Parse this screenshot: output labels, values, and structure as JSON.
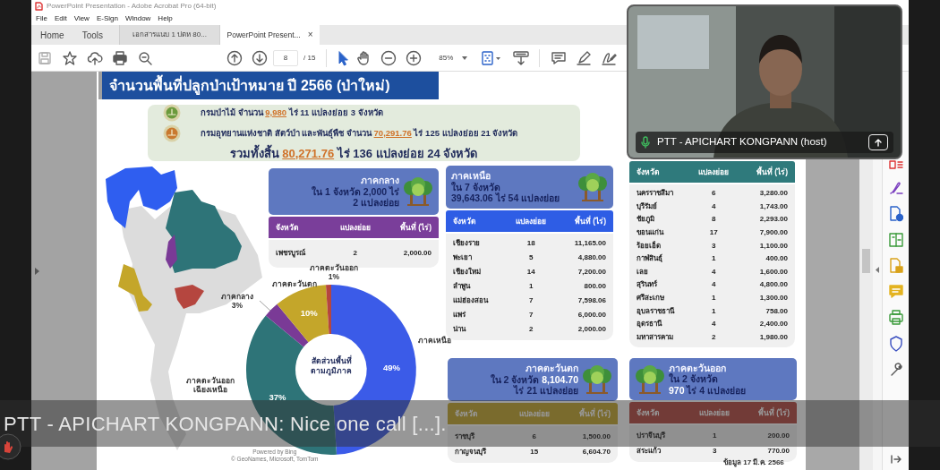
{
  "window": {
    "title": "PowerPoint Presentation - Adobe Acrobat Pro (64-bit)"
  },
  "menu": [
    "File",
    "Edit",
    "View",
    "E-Sign",
    "Window",
    "Help"
  ],
  "nav": [
    "Home",
    "Tools"
  ],
  "tabs": [
    {
      "label": "เอกสารแนบ 1 ปตห 80...",
      "selected": false
    },
    {
      "label": "PowerPoint Present...",
      "selected": true,
      "close": "×"
    }
  ],
  "toolbar": {
    "page": "8",
    "pages": "/ 15",
    "zoom": "85%"
  },
  "slide": {
    "title": "จำนวนพื้นที่ปลูกป่าเป้าหมาย ปี 2566 (ป่าใหม่)",
    "summary": [
      {
        "kind": "agency",
        "before": "กรมป่าไม้ จำนวน ",
        "amount": "9,980",
        "after": " ไร่ 11 แปลงย่อย 3 จังหวัด"
      },
      {
        "kind": "agency",
        "before": "กรมอุทยานแห่งชาติ สัตว์ป่า และพันธุ์พืช จำนวน ",
        "amount": "70,291.76",
        "after": " ไร่ 125 แปลงย่อย 21 จังหวัด"
      },
      {
        "kind": "total",
        "before": "รวมทั้งสิ้น ",
        "amount": "80,271.76",
        "after": " ไร่ 136 แปลงย่อย 24 จังหวัด"
      }
    ],
    "regions": [
      {
        "title": "ภาคกลาง",
        "lines": [
          [
            {
              "text": "ใน 1 จังหวัด 2,000 ไร่",
              "light": false
            }
          ],
          [
            {
              "text": "2 แปลงย่อย",
              "light": false
            }
          ]
        ],
        "color": "#7a3e9a",
        "columns": [
          "จังหวัด",
          "แปลงย่อย",
          "พื้นที่ (ไร่)"
        ],
        "rows": [
          [
            "เพชรบูรณ์",
            "2",
            "2,000.00"
          ]
        ]
      },
      {
        "title": "ภาคเหนือ",
        "lines": [
          [
            {
              "text": "ใน 7 จังหวัด",
              "light": false
            }
          ],
          [
            {
              "text": "39,643.06 ไร่ 54 แปลงย่อย",
              "light": false
            }
          ]
        ],
        "color": "#2e5de5",
        "columns": [
          "จังหวัด",
          "แปลงย่อย",
          "พื้นที่ (ไร่)"
        ],
        "rows": [
          [
            "เชียงราย",
            "18",
            "11,165.00"
          ],
          [
            "พะเยา",
            "5",
            "4,880.00"
          ],
          [
            "เชียงใหม่",
            "14",
            "7,200.00"
          ],
          [
            "ลำพูน",
            "1",
            "800.00"
          ],
          [
            "แม่ฮ่องสอน",
            "7",
            "7,598.06"
          ],
          [
            "แพร่",
            "7",
            "6,000.00"
          ],
          [
            "น่าน",
            "2",
            "2,000.00"
          ]
        ]
      },
      {
        "color": "#2f7a7c",
        "columns": [
          "จังหวัด",
          "แปลงย่อย",
          "พื้นที่ (ไร่)"
        ],
        "rows": [
          [
            "นครราชสีมา",
            "6",
            "3,280.00"
          ],
          [
            "บุรีรัมย์",
            "4",
            "1,743.00"
          ],
          [
            "ชัยภูมิ",
            "8",
            "2,293.00"
          ],
          [
            "ขอนแก่น",
            "17",
            "7,900.00"
          ],
          [
            "ร้อยเอ็ด",
            "3",
            "1,100.00"
          ],
          [
            "กาฬสินธุ์",
            "1",
            "400.00"
          ],
          [
            "เลย",
            "4",
            "1,600.00"
          ],
          [
            "สุรินทร์",
            "4",
            "4,800.00"
          ],
          [
            "ศรีสะเกษ",
            "1",
            "1,300.00"
          ],
          [
            "อุบลราชธานี",
            "1",
            "758.00"
          ],
          [
            "อุดรธานี",
            "4",
            "2,400.00"
          ],
          [
            "มหาสารคาม",
            "2",
            "1,980.00"
          ]
        ]
      },
      {
        "title": "ภาคตะวันตก",
        "lines": [
          [
            {
              "text": "ใน 2 จังหวัด ",
              "light": false
            },
            {
              "text": "8,104.70",
              "light": true
            }
          ],
          [
            {
              "text": "ไร่ 21 แปลงย่อย",
              "light": false
            }
          ]
        ],
        "columns": [
          "จังหวัด",
          "แปลงย่อย",
          "พื้นที่ (ไร่)"
        ],
        "rows": [
          [
            "ราชบุรี",
            "6",
            "1,500.00"
          ],
          [
            "กาญจนบุรี",
            "15",
            "6,604.70"
          ]
        ]
      },
      {
        "title": "ภาคตะวันออก",
        "lines": [
          [
            {
              "text": "ใน 2 จังหวัด",
              "light": false
            }
          ],
          [
            {
              "text": "970",
              "light": true
            },
            {
              "text": " ไร่ 4 แปลงย่อย",
              "light": false
            }
          ]
        ],
        "columns": [
          "จังหวัด",
          "แปลงย่อย",
          "พื้นที่ (ไร่)"
        ],
        "rows": [
          [
            "ปราจีนบุรี",
            "1",
            "200.00"
          ],
          [
            "สระแก้ว",
            "3",
            "770.00"
          ]
        ]
      }
    ],
    "chart_data": {
      "type": "donut",
      "title": "สัดส่วนพื้นที่ ตามภูมิภาค",
      "categories": [
        "ภาคเหนือ",
        "ภาคตะวันออก เฉียงเหนือ",
        "ภาคกลาง",
        "ภาคตะวันตก",
        "ภาคตะวันออก"
      ],
      "series": [
        {
          "values": [
            49,
            37,
            3,
            10,
            1
          ]
        }
      ],
      "colors": [
        "#3b5be8",
        "#2e7478",
        "#7a3a96",
        "#c4a62a",
        "#b5463f"
      ],
      "value_labels": [
        "49%",
        "37%",
        "3%",
        "10%",
        "1%"
      ]
    },
    "map_attribution": [
      "Powered by Bing",
      "© GeoNames, Microsoft, TomTom"
    ],
    "footnote": "ข้อมูล 17 มี.ค. 2566"
  },
  "video": {
    "name": "PTT - APICHART KONGPANN (host)"
  },
  "caption": {
    "text": "PTT - APICHART KONGPANN: Nice one call [...]."
  }
}
